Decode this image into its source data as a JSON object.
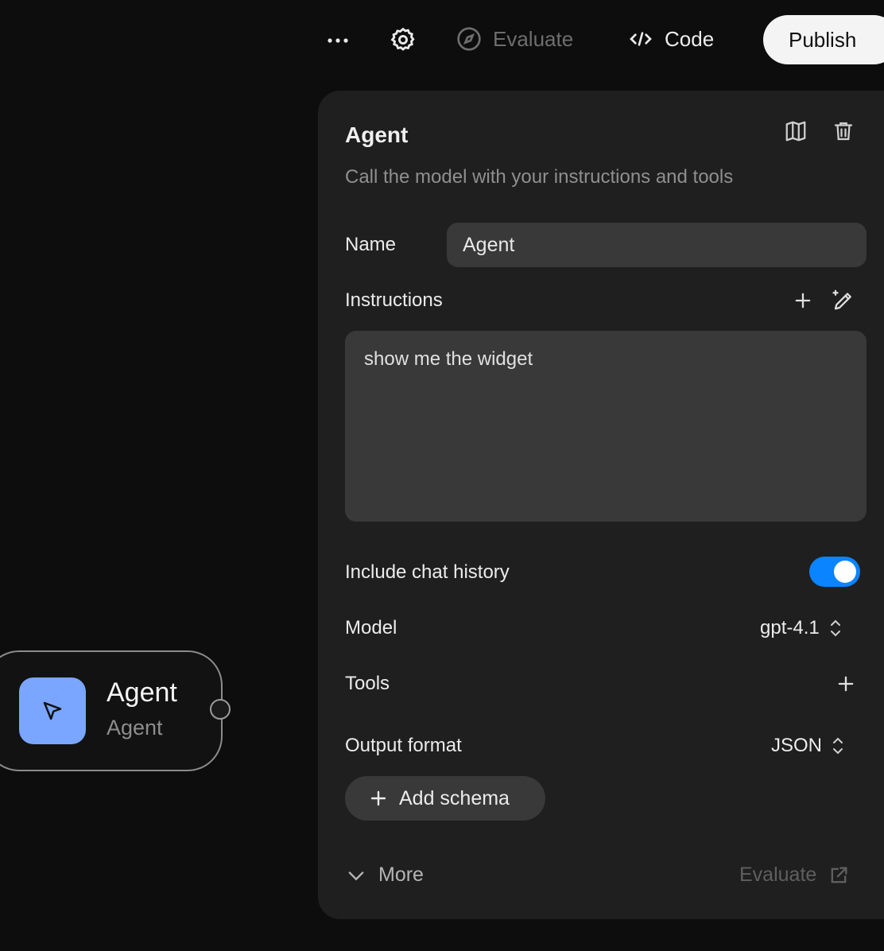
{
  "toolbar": {
    "more_icon": "ellipsis-icon",
    "settings_icon": "gear-icon",
    "evaluate_label": "Evaluate",
    "code_label": "Code",
    "publish_label": "Publish"
  },
  "panel": {
    "title": "Agent",
    "subtitle": "Call the model with your instructions and tools",
    "name_label": "Name",
    "name_value": "Agent",
    "instructions_label": "Instructions",
    "instructions_value": "show me the widget",
    "chat_history_label": "Include chat history",
    "chat_history_on": true,
    "model_label": "Model",
    "model_value": "gpt-4.1",
    "tools_label": "Tools",
    "output_label": "Output format",
    "output_value": "JSON",
    "add_schema_label": "Add schema",
    "more_label": "More",
    "evaluate_label": "Evaluate"
  },
  "node": {
    "title": "Agent",
    "subtitle": "Agent"
  },
  "colors": {
    "accent": "#0a84ff",
    "node_icon_bg": "#7aa6ff",
    "panel_bg": "#1f1f1f",
    "canvas_bg": "#0d0d0d"
  }
}
